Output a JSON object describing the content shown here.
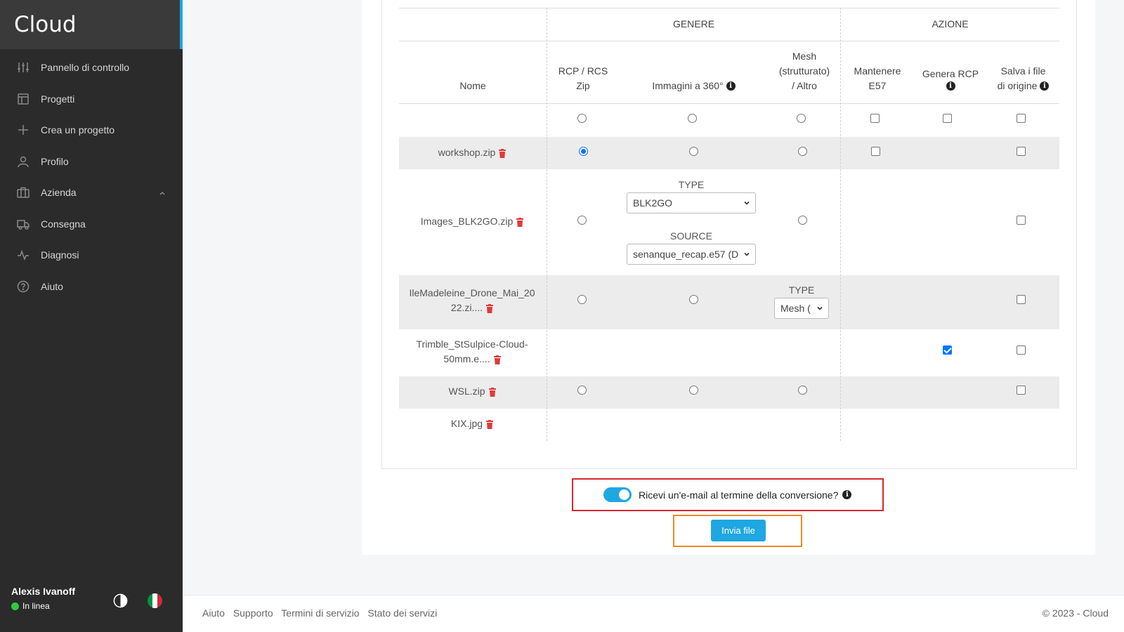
{
  "app": {
    "name": "Cloud"
  },
  "sidebar": {
    "items": [
      {
        "label": "Pannello di controllo",
        "icon": "sliders-icon"
      },
      {
        "label": "Progetti",
        "icon": "layout-icon"
      },
      {
        "label": "Crea un progetto",
        "icon": "plus-icon"
      },
      {
        "label": "Profilo",
        "icon": "user-icon"
      },
      {
        "label": "Azienda",
        "icon": "briefcase-icon",
        "expanded": true
      },
      {
        "label": "Consegna",
        "icon": "truck-icon"
      },
      {
        "label": "Diagnosi",
        "icon": "activity-icon"
      },
      {
        "label": "Aiuto",
        "icon": "help-circle-icon"
      }
    ],
    "user": {
      "name": "Alexis Ivanoff",
      "status": "In linea"
    }
  },
  "table": {
    "group_headers": {
      "genere": "GENERE",
      "azione": "AZIONE"
    },
    "columns": {
      "nome": "Nome",
      "rcp": [
        "RCP / RCS",
        "Zip"
      ],
      "img360": "Immagini a 360°",
      "mesh": [
        "Mesh",
        "(strutturato)",
        "/ Altro"
      ],
      "e57": [
        "Mantenere",
        "E57"
      ],
      "genera": "Genera RCP",
      "salva": [
        "Salva i file",
        "di origine"
      ]
    },
    "rows": [
      {
        "name": "workshop.zip"
      },
      {
        "name": "Images_BLK2GO.zip",
        "type_label": "TYPE",
        "type_value": "BLK2GO",
        "source_label": "SOURCE",
        "source_value": "senanque_recap.e57 (D"
      },
      {
        "name": [
          "IleMadeleine_Drone_Mai_20",
          "22.zi...."
        ],
        "type_label": "TYPE",
        "type_value": "Mesh ("
      },
      {
        "name": [
          "Trimble_StSulpice-Cloud-",
          "50mm.e...."
        ]
      },
      {
        "name": "WSL.zip"
      },
      {
        "name": "KIX.jpg"
      }
    ]
  },
  "email": {
    "label": "Ricevi un'e-mail al termine della conversione?",
    "enabled": true
  },
  "submit": {
    "label": "Invia file"
  },
  "footer": {
    "links": [
      "Aiuto",
      "Supporto",
      "Termini di servizio",
      "Stato dei servizi"
    ],
    "copyright": "© 2023 - Cloud"
  },
  "colors": {
    "accent": "#1ea7e1",
    "sidebar": "#2b2b2b",
    "delete": "#e03b3b",
    "highlight_red": "#d9262e",
    "highlight_orange": "#f08a24"
  }
}
